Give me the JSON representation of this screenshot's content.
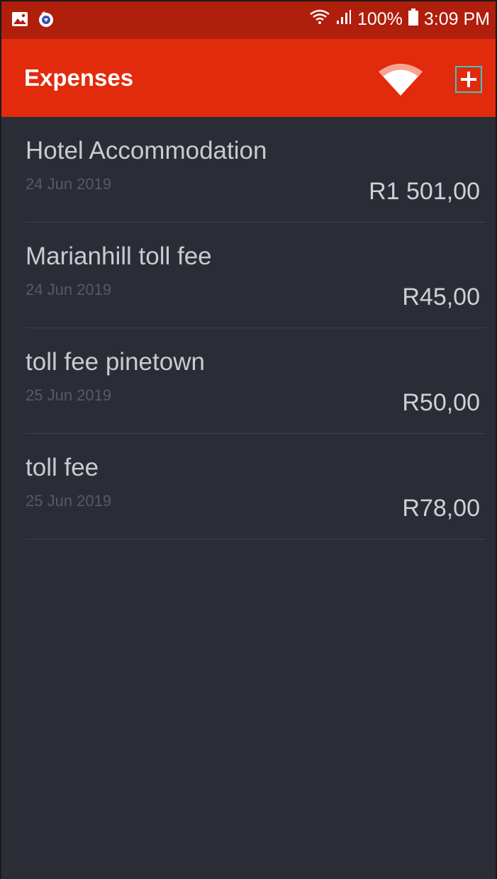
{
  "status_bar": {
    "battery": "100%",
    "time": "3:09 PM"
  },
  "app_bar": {
    "title": "Expenses"
  },
  "expenses": [
    {
      "title": "Hotel Accommodation",
      "date": "24 Jun 2019",
      "amount": "R1 501,00"
    },
    {
      "title": "Marianhill toll fee",
      "date": "24 Jun 2019",
      "amount": "R45,00"
    },
    {
      "title": "toll fee pinetown",
      "date": "25 Jun 2019",
      "amount": "R50,00"
    },
    {
      "title": "toll fee",
      "date": "25 Jun 2019",
      "amount": "R78,00"
    }
  ],
  "colors": {
    "status_bar": "#b01e0c",
    "app_bar": "#e22a0c",
    "background": "#2a2d36",
    "accent_outline": "#3ec6c0"
  }
}
